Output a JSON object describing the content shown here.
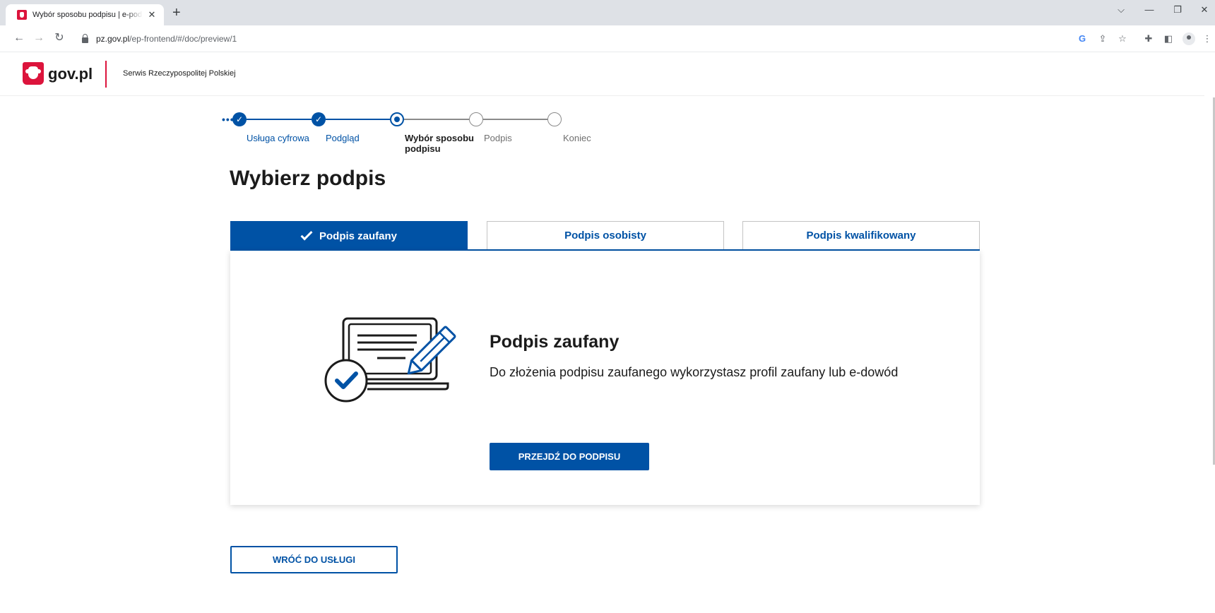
{
  "browser": {
    "tab_title": "Wybór sposobu podpisu | e-podpis",
    "tab_close": "✕",
    "new_tab": "+",
    "url_host": "pz.gov.pl",
    "url_path": "/ep-frontend/#/doc/preview/1"
  },
  "header": {
    "logo_text": "gov.pl",
    "subtitle": "Serwis Rzeczypospolitej Polskiej"
  },
  "stepper": {
    "more": "•••",
    "steps": [
      {
        "label": "Usługa cyfrowa",
        "state": "done"
      },
      {
        "label": "Podgląd",
        "state": "done"
      },
      {
        "label": "Wybór sposobu podpisu",
        "state": "current"
      },
      {
        "label": "Podpis",
        "state": "future"
      },
      {
        "label": "Koniec",
        "state": "future"
      }
    ]
  },
  "page": {
    "title": "Wybierz podpis"
  },
  "tabs": [
    {
      "label": "Podpis zaufany",
      "active": true
    },
    {
      "label": "Podpis osobisty",
      "active": false
    },
    {
      "label": "Podpis kwalifikowany",
      "active": false
    }
  ],
  "card": {
    "title": "Podpis zaufany",
    "description": "Do złożenia podpisu zaufanego wykorzystasz profil zaufany lub e-dowód",
    "button": "PRZEJDŹ DO PODPISU"
  },
  "back_button": "WRÓĆ DO USŁUGI",
  "colors": {
    "primary": "#0052a5",
    "brand_red": "#dc143c",
    "text": "#1b1b1b"
  }
}
